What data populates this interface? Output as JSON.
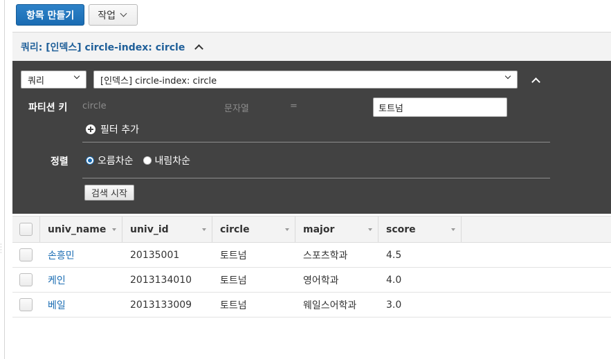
{
  "toolbar": {
    "create_item_label": "항목 만들기",
    "actions_label": "작업"
  },
  "query": {
    "header_title": "쿼리: [인덱스] circle-index: circle",
    "mode_select_value": "쿼리",
    "index_select_value": "[인덱스] circle-index: circle",
    "partition_key_label": "파티션 키",
    "partition_key_name": "circle",
    "partition_key_type": "문자열",
    "operator": "=",
    "partition_key_value": "토트넘",
    "add_filter_label": "필터 추가",
    "sort_label": "정렬",
    "sort_options": [
      {
        "label": "오름차순",
        "selected": true
      },
      {
        "label": "내림차순",
        "selected": false
      }
    ],
    "start_search_label": "검색 시작"
  },
  "table": {
    "columns": [
      "univ_name",
      "univ_id",
      "circle",
      "major",
      "score"
    ],
    "rows": [
      {
        "univ_name": "손흥민",
        "univ_id": "20135001",
        "circle": "토트넘",
        "major": "스포츠학과",
        "score": "4.5"
      },
      {
        "univ_name": "케인",
        "univ_id": "2013134010",
        "circle": "토트넘",
        "major": "영어학과",
        "score": "4.0"
      },
      {
        "univ_name": "베일",
        "univ_id": "2013133009",
        "circle": "토트넘",
        "major": "웨일스어학과",
        "score": "3.0"
      }
    ]
  },
  "colors": {
    "primary": "#1a6cb3",
    "panel_bg": "#424242",
    "header_link": "#1f5f99"
  },
  "icons": [
    "chevron-down-icon",
    "chevron-up-icon",
    "plus-circle-icon",
    "sort-icon"
  ]
}
